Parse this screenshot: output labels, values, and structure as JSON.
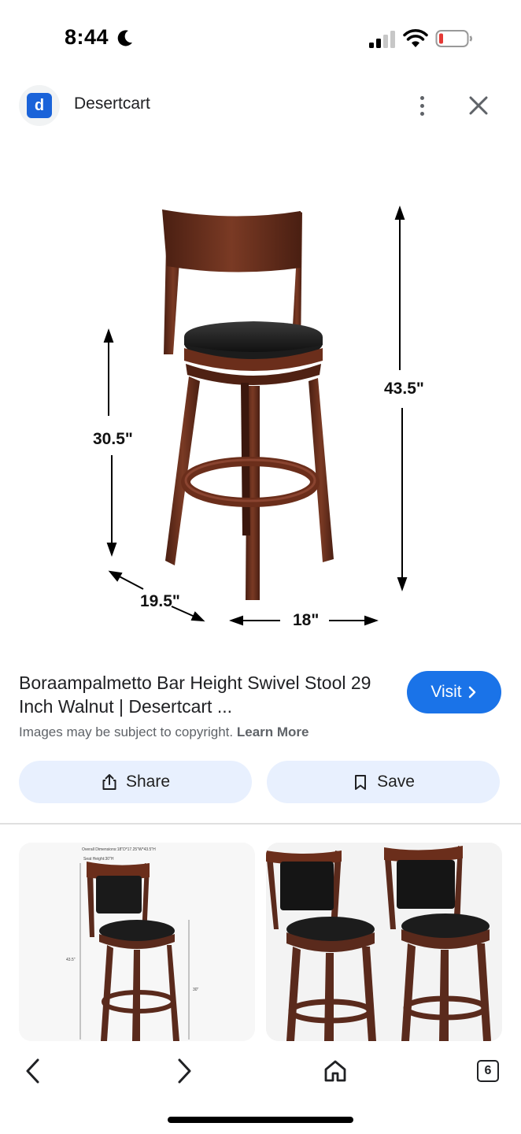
{
  "status_bar": {
    "time": "8:44",
    "icons": [
      "moon-icon",
      "signal-icon",
      "wifi-icon",
      "battery-icon"
    ]
  },
  "source": {
    "logo_letter": "d",
    "site_name": "Desertcart",
    "icons": [
      "more-vert-icon",
      "close-icon"
    ]
  },
  "hero": {
    "back_height": "43.5\"",
    "seat_height": "30.5\"",
    "depth": "19.5\"",
    "width": "18\""
  },
  "result": {
    "title": "Boraampalmetto Bar Height Swivel Stool 29 Inch Walnut | Desertcart ...",
    "visit_label": "Visit",
    "copyright_text": "Images may be subject to copyright.",
    "learn_more": "Learn More"
  },
  "actions": {
    "share_label": "Share",
    "save_label": "Save"
  },
  "related": {
    "thumb1_caption": "Overall Dimensions:18\"D*17.25\"W*43.5\"H",
    "thumb1_seat": "Seat Height:30\"H",
    "thumb1_left": "43.5\"",
    "thumb1_right": "30\""
  },
  "bottom_nav": {
    "tab_count": "6",
    "icons": [
      "back-icon",
      "forward-icon",
      "home-icon",
      "tabs-icon"
    ]
  },
  "colors": {
    "accent": "#1a73e8",
    "chip_bg": "#e8f0fe",
    "wood": "#5a2a1c",
    "battery_low": "#e53935"
  }
}
